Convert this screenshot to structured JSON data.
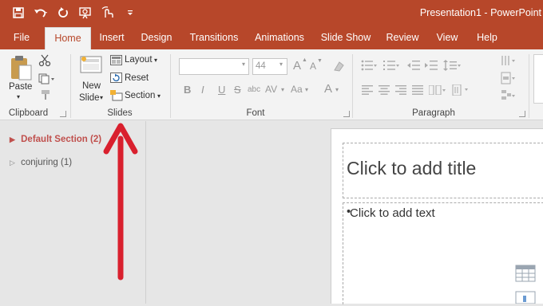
{
  "title": {
    "text": "Presentation1  -  PowerPoint"
  },
  "quick_access": {
    "icons": [
      "save-icon",
      "undo-icon",
      "redo-icon",
      "start-from-beginning-icon",
      "touch-mode-icon",
      "customize-icon"
    ]
  },
  "tabs": [
    {
      "label": "File"
    },
    {
      "label": "Home"
    },
    {
      "label": "Insert"
    },
    {
      "label": "Design"
    },
    {
      "label": "Transitions"
    },
    {
      "label": "Animations"
    },
    {
      "label": "Slide Show"
    },
    {
      "label": "Review"
    },
    {
      "label": "View"
    },
    {
      "label": "Help"
    }
  ],
  "ribbon": {
    "clipboard": {
      "group_label": "Clipboard",
      "paste": "Paste"
    },
    "slides": {
      "group_label": "Slides",
      "new_slide_line1": "New",
      "new_slide_line2": "Slide",
      "layout": "Layout",
      "reset": "Reset",
      "section": "Section"
    },
    "font": {
      "group_label": "Font",
      "font_size": "44",
      "bold": "B",
      "italic": "I",
      "underline": "U",
      "strikethrough": "S",
      "shadow": "abc",
      "spacing": "AV",
      "case": "Aa",
      "color": "A",
      "grow": "A",
      "shrink": "A"
    },
    "paragraph": {
      "group_label": "Paragraph"
    }
  },
  "sections": [
    {
      "label": "Default Section (2)"
    },
    {
      "label": "conjuring (1)"
    }
  ],
  "slide": {
    "title_placeholder": "Click to add title",
    "body_placeholder": "Click to add text"
  },
  "colors": {
    "accent": "#b7472a",
    "annotation_arrow": "#d9202e",
    "section_header": "#c0504d"
  }
}
